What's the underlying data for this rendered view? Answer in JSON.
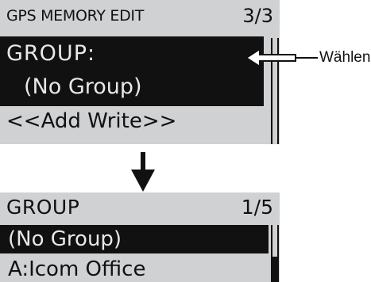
{
  "screen1": {
    "title": "GPS MEMORY EDIT",
    "page": "3/3",
    "selected_label": "GROUP:",
    "selected_value": "(No Group)",
    "next_item": "<<Add Write>>"
  },
  "screen2": {
    "title": "GROUP",
    "page": "1/5",
    "items": [
      "(No Group)",
      "A:Icom Office"
    ]
  },
  "callout": {
    "label": "Wählen"
  }
}
